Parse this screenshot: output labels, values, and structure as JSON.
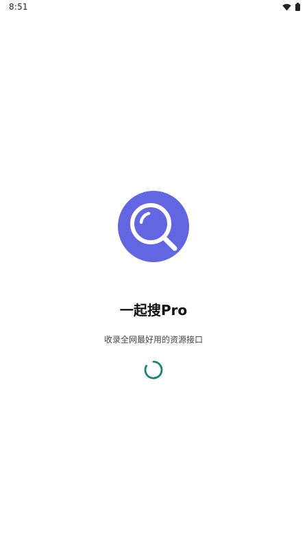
{
  "status_bar": {
    "time": "8:51",
    "icons": [
      "wifi-icon",
      "battery-icon"
    ]
  },
  "splash": {
    "logo_icon": "search-icon",
    "title": "一起搜Pro",
    "subtitle": "收录全网最好用的资源接口",
    "loading_indicator": "loading-spinner"
  },
  "colors": {
    "logo_background": "#6366e1",
    "logo_glyph": "#ffffff",
    "spinner": "#14857a",
    "background": "#ffffff"
  }
}
